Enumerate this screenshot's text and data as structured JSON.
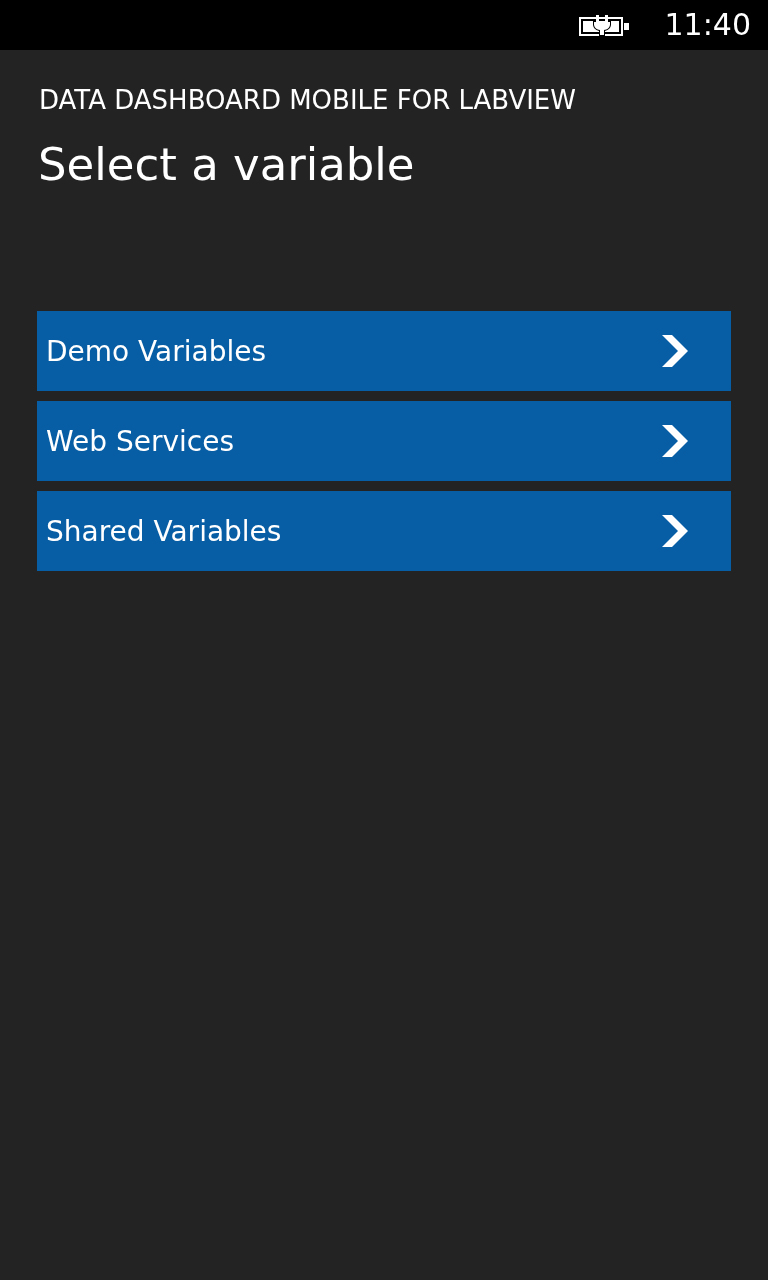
{
  "status_bar": {
    "time": "11:40"
  },
  "app_title": "DATA DASHBOARD MOBILE FOR LABVIEW",
  "page_title": "Select a variable",
  "items": [
    {
      "label": "Demo Variables"
    },
    {
      "label": "Web Services"
    },
    {
      "label": "Shared Variables"
    }
  ]
}
